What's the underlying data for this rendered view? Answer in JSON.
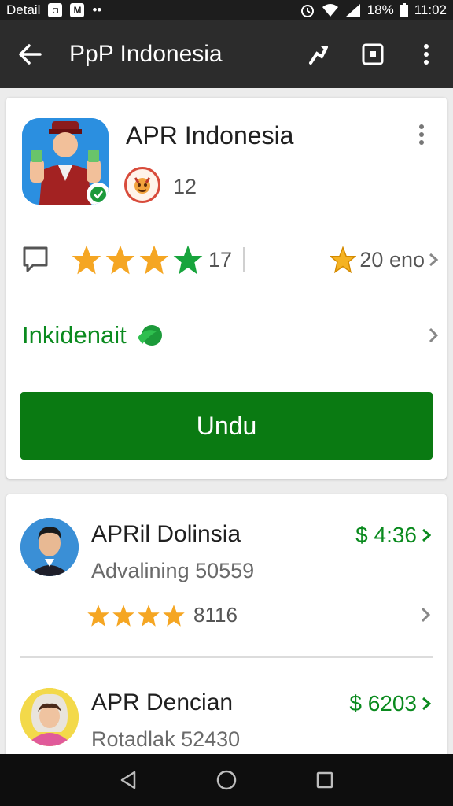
{
  "status_bar": {
    "left_label": "Detail",
    "battery": "18%",
    "time": "11:02",
    "icons": [
      "notification-icon",
      "gmail-icon",
      "more-dots-icon",
      "alarm-icon",
      "wifi-icon",
      "signal-icon",
      "battery-icon"
    ]
  },
  "app_bar": {
    "title": "PpP Indonesia",
    "back_icon": "arrow-left-icon",
    "actions": [
      "share-icon",
      "screenshot-icon",
      "overflow-menu-icon"
    ]
  },
  "app_card": {
    "name": "APR Indonesia",
    "developer_count": "12",
    "rating_count": "17",
    "installs": "20 eno",
    "stars": 4,
    "info_link": "Inkidenait",
    "download_label": "Undu"
  },
  "list": [
    {
      "title": "APRil Dolinsia",
      "subtitle": "Advalining 50559",
      "price": "$ 4:36",
      "rating_count": "8116",
      "stars": 4
    },
    {
      "title": "APR Dencian",
      "subtitle": "Rotadlak 52430",
      "price": "$ 6203"
    }
  ],
  "colors": {
    "accent_green": "#0a7a12",
    "link_green": "#0a8a1e",
    "star_orange": "#f5a623",
    "star_green": "#17a43c",
    "app_bar": "#2c2c2c"
  }
}
